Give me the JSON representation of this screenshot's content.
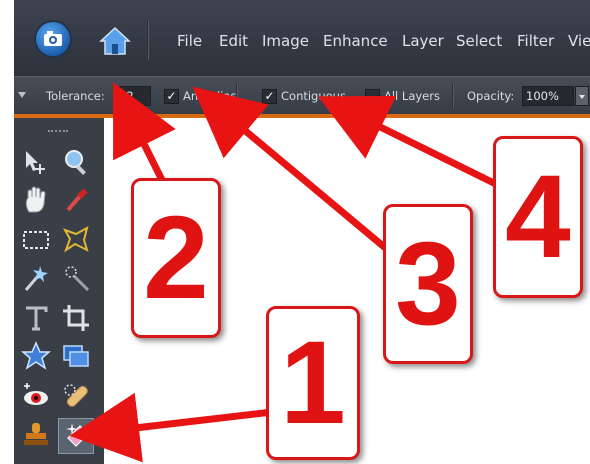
{
  "menu": {
    "items": [
      "File",
      "Edit",
      "Image",
      "Enhance",
      "Layer",
      "Select",
      "Filter",
      "View"
    ]
  },
  "options": {
    "tolerance_label": "Tolerance:",
    "tolerance_value": "32",
    "antialias_label": "Anti-alias",
    "antialias_checked": true,
    "contiguous_label": "Contiguous",
    "contiguous_checked": true,
    "all_layers_label": "All Layers",
    "all_layers_checked": false,
    "opacity_label": "Opacity:",
    "opacity_value": "100%"
  },
  "callouts": [
    "1",
    "2",
    "3",
    "4"
  ],
  "colors": {
    "accent": "#d86a14",
    "callout_red": "#e01313"
  },
  "icons": [
    "photo-camera-icon",
    "home-icon",
    "move-tool-icon",
    "zoom-tool-icon",
    "hand-tool-icon",
    "eyedropper-icon",
    "marquee-tool-icon",
    "lasso-tool-icon",
    "magic-wand-icon",
    "quick-selection-icon",
    "type-tool-icon",
    "crop-tool-icon",
    "cookie-cutter-icon",
    "straighten-icon",
    "red-eye-icon",
    "healing-brush-icon",
    "clone-stamp-icon",
    "magic-eraser-icon"
  ]
}
